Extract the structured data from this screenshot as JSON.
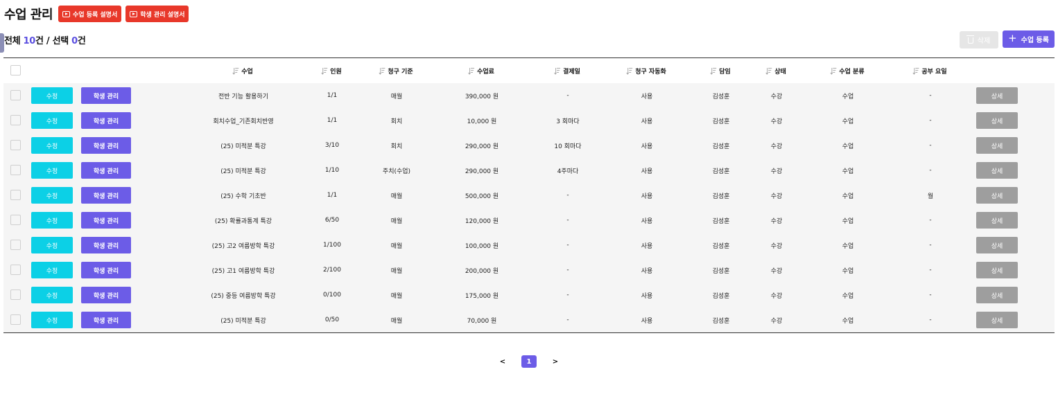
{
  "header": {
    "title": "수업 관리",
    "guide_buttons": [
      {
        "label": "수업 등록 설명서",
        "icon": "youtube-icon"
      },
      {
        "label": "학생 관리 설명서",
        "icon": "youtube-icon"
      }
    ]
  },
  "summary": {
    "total_prefix": "전체 ",
    "total_count": "10",
    "total_unit": "건 / 선택 ",
    "selected_count": "0",
    "selected_unit": "건"
  },
  "toolbar": {
    "delete_label": "삭제",
    "add_label": "수업 등록"
  },
  "table": {
    "columns": [
      "수업",
      "인원",
      "청구 기준",
      "수업료",
      "결제일",
      "청구 자동화",
      "담임",
      "상태",
      "수업 분류",
      "공부 요일"
    ],
    "edit_label": "수정",
    "student_label": "학생 관리",
    "detail_label": "상세",
    "rows": [
      {
        "class": "전반 기능 활용하기",
        "people": "1/1",
        "billing": "매월",
        "fee": "390,000 원",
        "payday": "-",
        "auto": "사용",
        "teacher": "김성훈",
        "status": "수강",
        "category": "수업",
        "days": "-"
      },
      {
        "class": "회치수업_기존회치반영",
        "people": "1/1",
        "billing": "회치",
        "fee": "10,000 원",
        "payday": "3 회마다",
        "auto": "사용",
        "teacher": "김성훈",
        "status": "수강",
        "category": "수업",
        "days": "-"
      },
      {
        "class": "(25) 미적분 특강",
        "people": "3/10",
        "billing": "회치",
        "fee": "290,000 원",
        "payday": "10 회마다",
        "auto": "사용",
        "teacher": "김성훈",
        "status": "수강",
        "category": "수업",
        "days": "-"
      },
      {
        "class": "(25) 미적분 특강",
        "people": "1/10",
        "billing": "주치(수업)",
        "fee": "290,000 원",
        "payday": "4주마다",
        "auto": "사용",
        "teacher": "김성훈",
        "status": "수강",
        "category": "수업",
        "days": "-"
      },
      {
        "class": "(25) 수학 기초반",
        "people": "1/1",
        "billing": "매월",
        "fee": "500,000 원",
        "payday": "-",
        "auto": "사용",
        "teacher": "김성훈",
        "status": "수강",
        "category": "수업",
        "days": "월"
      },
      {
        "class": "(25) 확률과통계 특강",
        "people": "6/50",
        "billing": "매월",
        "fee": "120,000 원",
        "payday": "-",
        "auto": "사용",
        "teacher": "김성훈",
        "status": "수강",
        "category": "수업",
        "days": "-"
      },
      {
        "class": "(25) 고2 여름방학 특강",
        "people": "1/100",
        "billing": "매월",
        "fee": "100,000 원",
        "payday": "-",
        "auto": "사용",
        "teacher": "김성훈",
        "status": "수강",
        "category": "수업",
        "days": "-"
      },
      {
        "class": "(25) 고1 여름방학 특강",
        "people": "2/100",
        "billing": "매월",
        "fee": "200,000 원",
        "payday": "-",
        "auto": "사용",
        "teacher": "김성훈",
        "status": "수강",
        "category": "수업",
        "days": "-"
      },
      {
        "class": "(25) 중등 여름방학 특강",
        "people": "0/100",
        "billing": "매월",
        "fee": "175,000 원",
        "payday": "-",
        "auto": "사용",
        "teacher": "김성훈",
        "status": "수강",
        "category": "수업",
        "days": "-"
      },
      {
        "class": "(25) 미적분 특강",
        "people": "0/50",
        "billing": "매월",
        "fee": "70,000 원",
        "payday": "-",
        "auto": "사용",
        "teacher": "김성훈",
        "status": "수강",
        "category": "수업",
        "days": "-"
      }
    ]
  },
  "pagination": {
    "prev": "<",
    "current": "1",
    "next": ">"
  },
  "colors": {
    "accent": "#6c5ce7",
    "edit": "#0cd0e6",
    "guide": "#e8382a",
    "detail": "#9e9e9e"
  }
}
